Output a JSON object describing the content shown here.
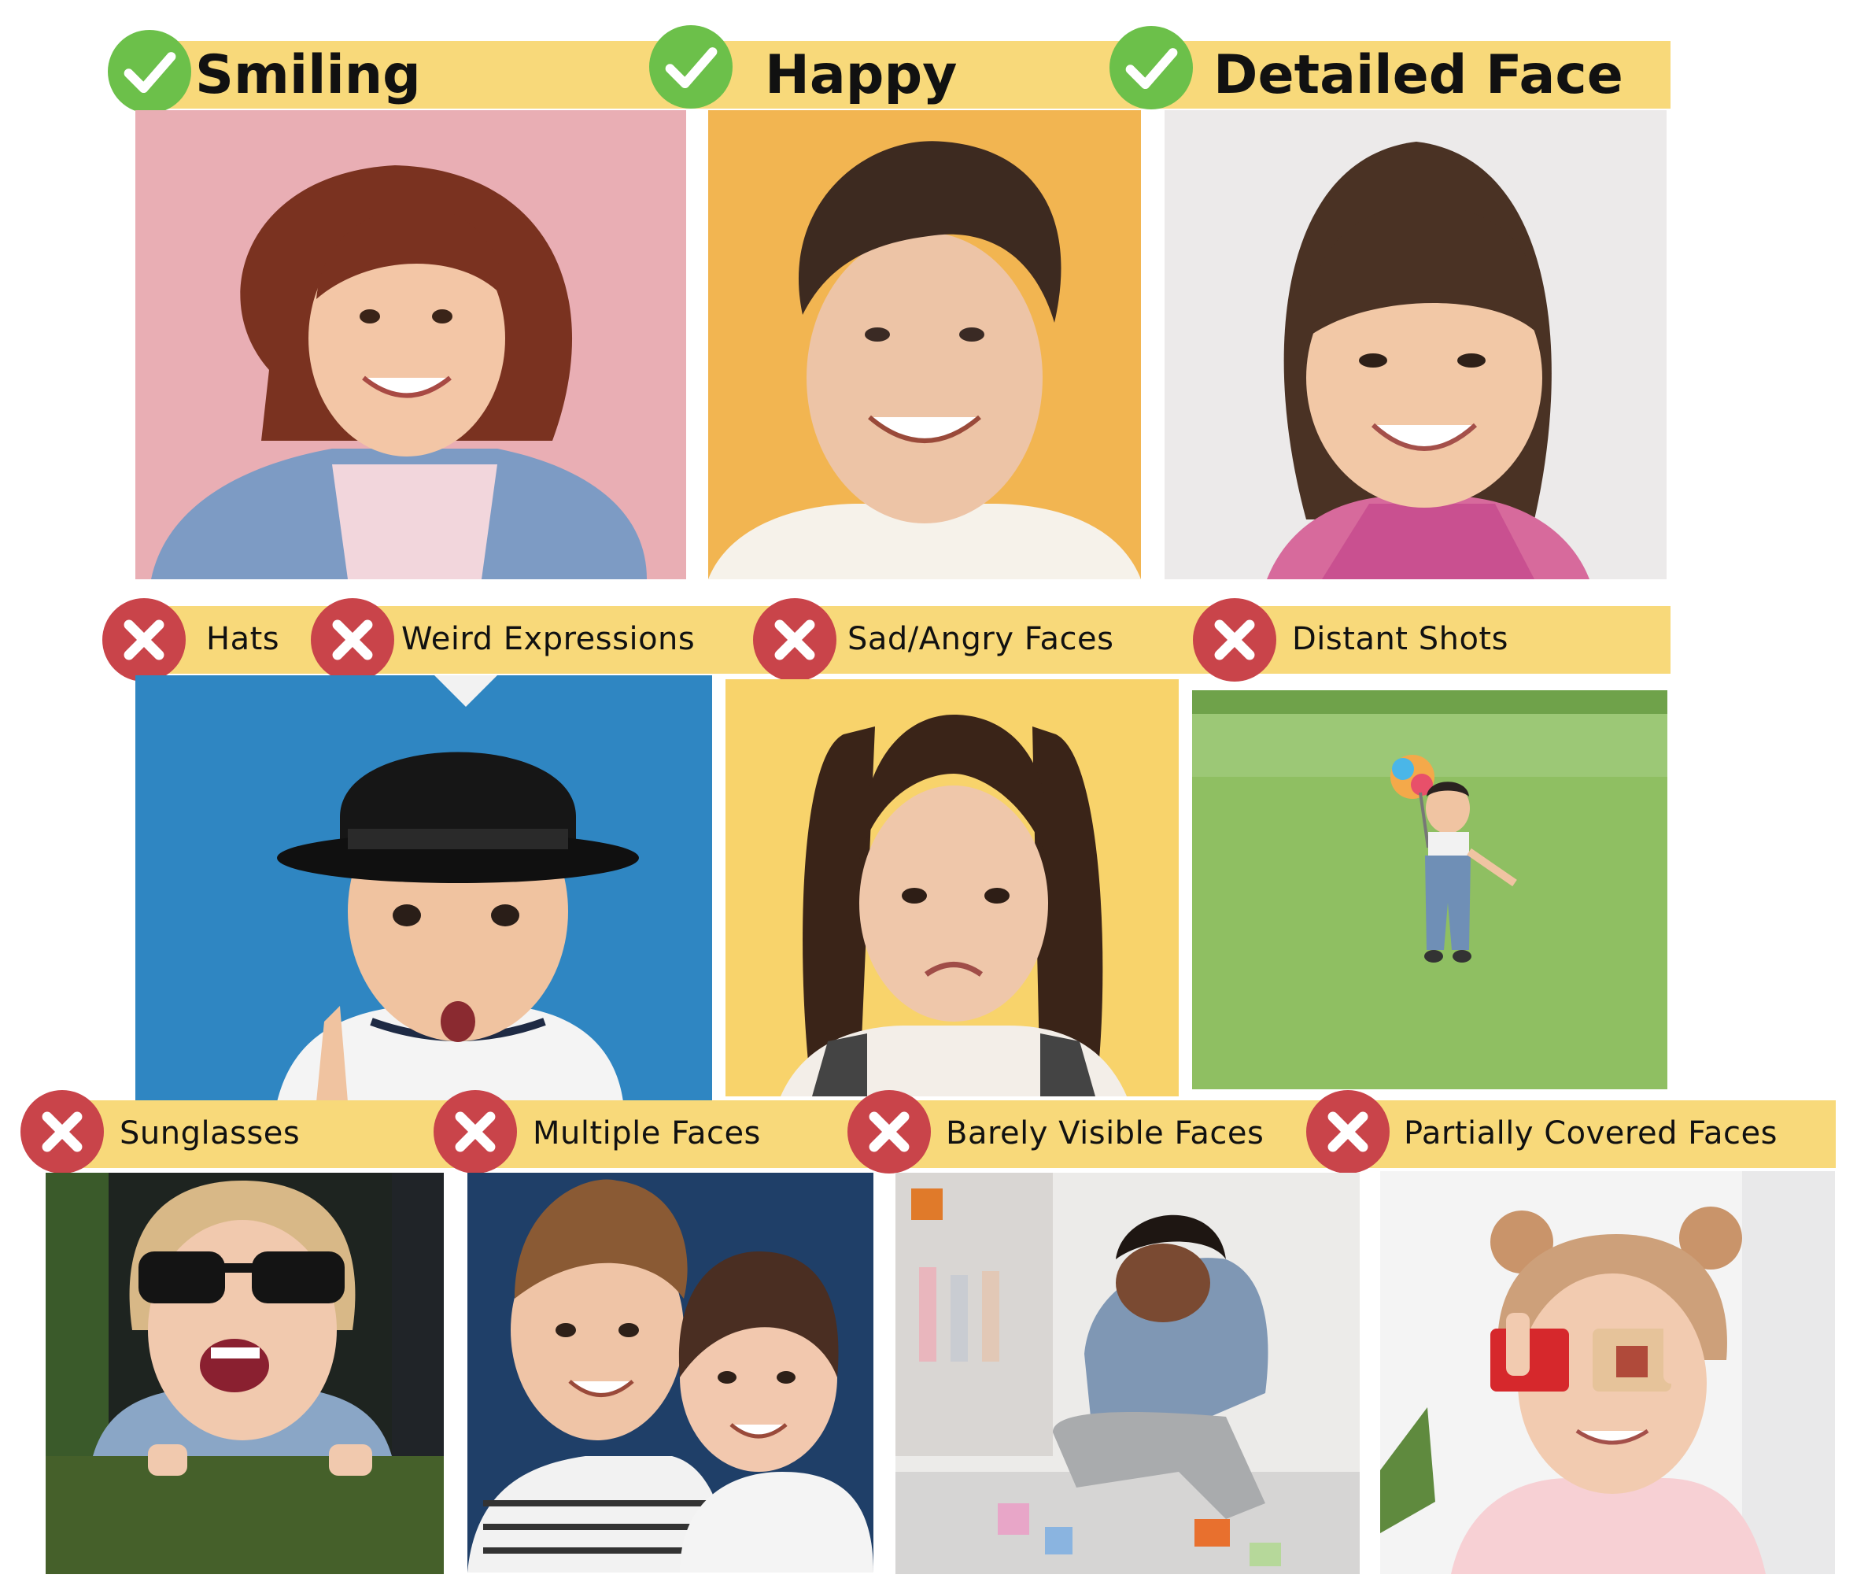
{
  "good_row": [
    {
      "id": "smiling",
      "label": "Smiling",
      "mark": "check-icon"
    },
    {
      "id": "happy",
      "label": "Happy",
      "mark": "check-icon"
    },
    {
      "id": "detailed",
      "label": "Detailed Face",
      "mark": "check-icon"
    }
  ],
  "bad_row_1": [
    {
      "id": "hats",
      "label": "Hats",
      "mark": "cross-icon"
    },
    {
      "id": "weird",
      "label": "Weird Expressions",
      "mark": "cross-icon"
    },
    {
      "id": "sad",
      "label": "Sad/Angry Faces",
      "mark": "cross-icon"
    },
    {
      "id": "distant",
      "label": "Distant Shots",
      "mark": "cross-icon"
    }
  ],
  "bad_row_2": [
    {
      "id": "sunglasses",
      "label": "Sunglasses",
      "mark": "cross-icon"
    },
    {
      "id": "multiple",
      "label": "Multiple Faces",
      "mark": "cross-icon"
    },
    {
      "id": "barely",
      "label": "Barely Visible Faces",
      "mark": "cross-icon"
    },
    {
      "id": "partial",
      "label": "Partially Covered Faces",
      "mark": "cross-icon"
    }
  ],
  "colors": {
    "banner": "#f8d97a",
    "check_green": "#6cc04a",
    "cross_red": "#c9444a"
  }
}
